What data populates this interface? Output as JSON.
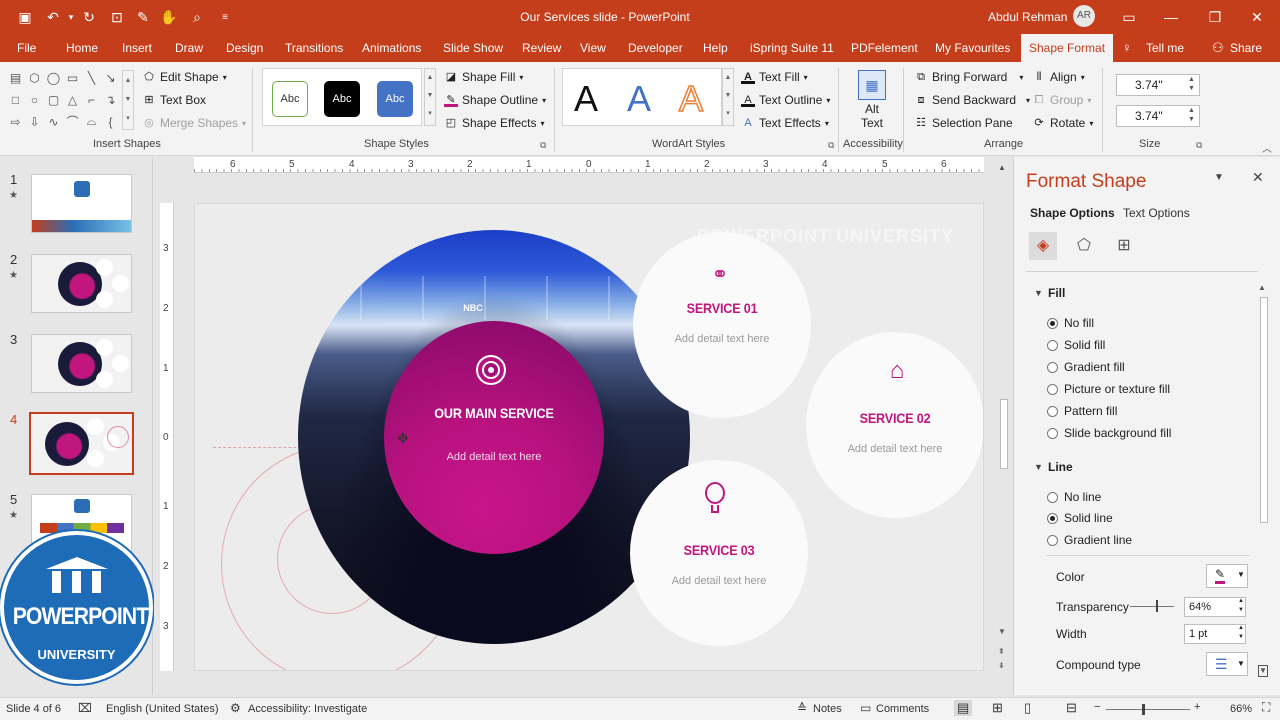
{
  "app": {
    "title": "Our Services slide  -  PowerPoint",
    "user": "Abdul Rehman",
    "user_initials": "AR",
    "accent": "#c43e1c"
  },
  "tabs": [
    "File",
    "Home",
    "Insert",
    "Draw",
    "Design",
    "Transitions",
    "Animations",
    "Slide Show",
    "Review",
    "View",
    "Developer",
    "Help",
    "iSpring Suite 11",
    "PDFelement",
    "My Favourites",
    "Shape Format",
    "Tell me",
    "Share"
  ],
  "ribbon": {
    "insert_shapes": {
      "edit_shape": "Edit Shape",
      "text_box": "Text Box",
      "merge_shapes": "Merge Shapes",
      "label": "Insert Shapes"
    },
    "shape_styles": {
      "abc": "Abc",
      "shape_fill": "Shape Fill",
      "shape_outline": "Shape Outline",
      "shape_effects": "Shape Effects",
      "label": "Shape Styles"
    },
    "wordart": {
      "a": "A",
      "text_fill": "Text Fill",
      "text_outline": "Text Outline",
      "text_effects": "Text Effects",
      "label": "WordArt Styles"
    },
    "accessibility": {
      "alt_text_1": "Alt",
      "alt_text_2": "Text",
      "label": "Accessibility"
    },
    "arrange": {
      "bring_forward": "Bring Forward",
      "send_backward": "Send Backward",
      "selection_pane": "Selection Pane",
      "align": "Align",
      "group": "Group",
      "rotate": "Rotate",
      "label": "Arrange"
    },
    "size": {
      "height": "3.74\"",
      "width": "3.74\"",
      "label": "Size"
    }
  },
  "thumbnails": [
    {
      "num": "1",
      "star": "★"
    },
    {
      "num": "2",
      "star": "★"
    },
    {
      "num": "3",
      "star": ""
    },
    {
      "num": "4",
      "star": ""
    },
    {
      "num": "5",
      "star": "★"
    }
  ],
  "slide": {
    "watermark": "POWERPOINT UNIVERSITY",
    "main_title": "OUR MAIN SERVICE",
    "main_detail": "Add detail text here",
    "services": [
      {
        "title": "SERVICE 01",
        "detail": "Add detail text here",
        "icon": "handshake-icon"
      },
      {
        "title": "SERVICE 02",
        "detail": "Add detail text here",
        "icon": "bank-icon"
      },
      {
        "title": "SERVICE 03",
        "detail": "Add detail text here",
        "icon": "lightbulb-icon"
      }
    ],
    "magenta": "#c0167e"
  },
  "logo": {
    "top": "POWERPOINT",
    "bottom": "UNIVERSITY"
  },
  "ruler": {
    "h": [
      "6",
      "5",
      "4",
      "3",
      "2",
      "1",
      "0",
      "1",
      "2",
      "3",
      "4",
      "5",
      "6"
    ],
    "v": [
      "3",
      "2",
      "1",
      "0",
      "1",
      "2",
      "3"
    ]
  },
  "format_panel": {
    "title": "Format Shape",
    "tab_shape": "Shape Options",
    "tab_text": "Text Options",
    "fill_header": "Fill",
    "fill_options": [
      "No fill",
      "Solid fill",
      "Gradient fill",
      "Picture or texture fill",
      "Pattern fill",
      "Slide background fill"
    ],
    "line_header": "Line",
    "line_options": [
      "No line",
      "Solid line",
      "Gradient line"
    ],
    "color_label": "Color",
    "transparency_label": "Transparency",
    "transparency_value": "64%",
    "width_label": "Width",
    "width_value": "1 pt",
    "compound_label": "Compound type"
  },
  "status": {
    "slide": "Slide 4 of 6",
    "language": "English (United States)",
    "accessibility": "Accessibility: Investigate",
    "notes": "Notes",
    "comments": "Comments",
    "zoom": "66%"
  }
}
